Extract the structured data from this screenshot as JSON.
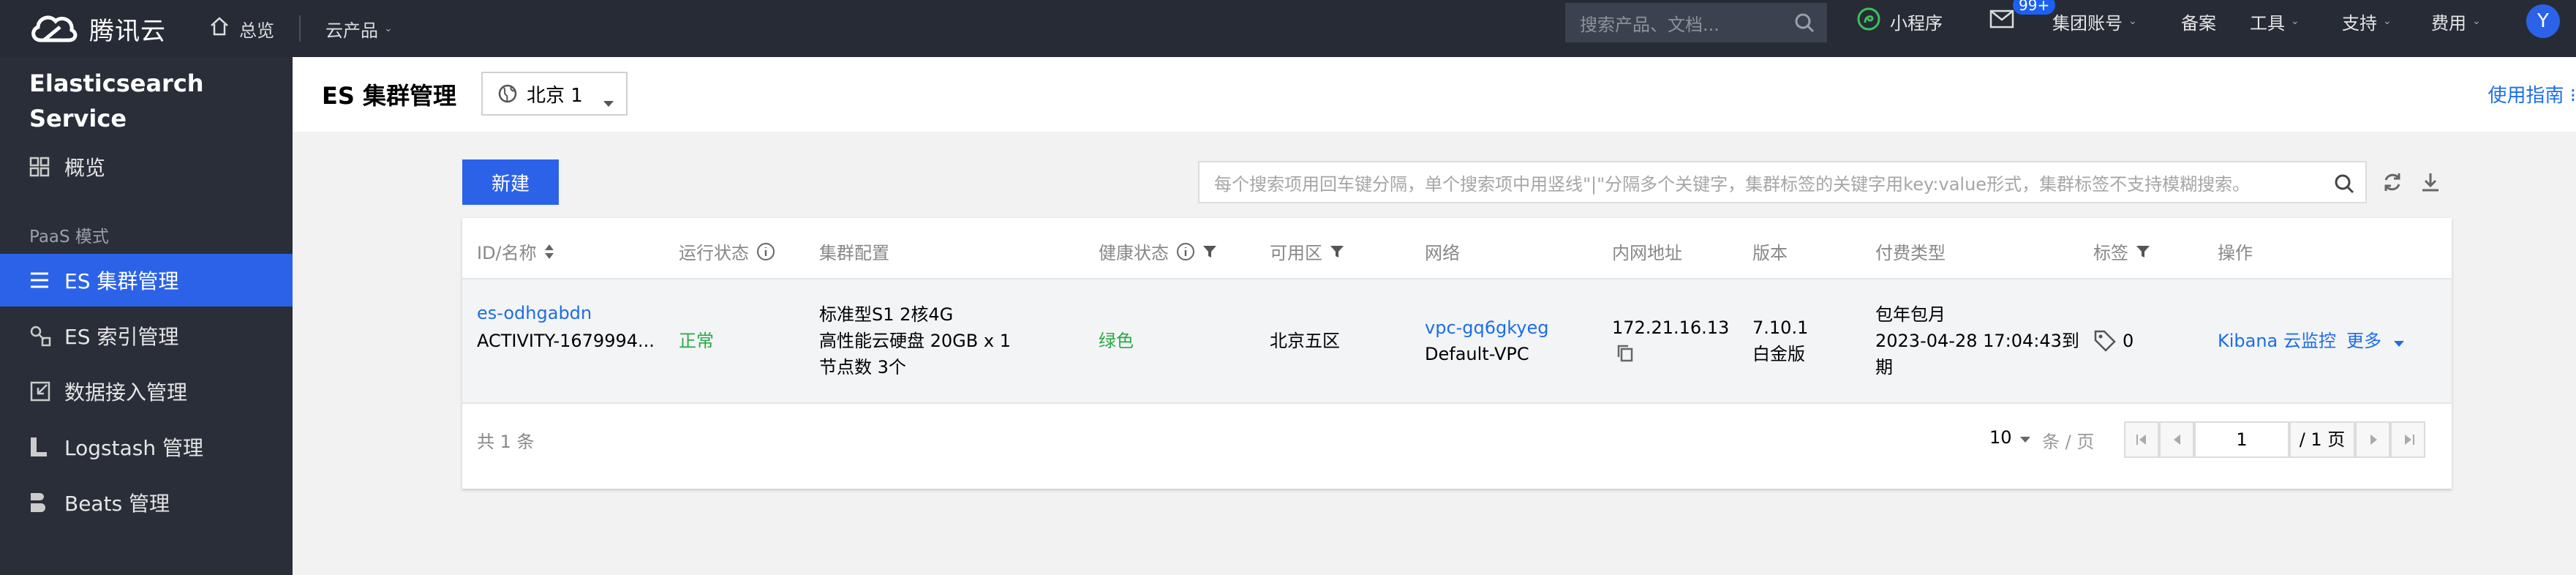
{
  "topbar": {
    "logo_text": "腾讯云",
    "overview_label": "总览",
    "products_label": "云产品",
    "search_placeholder": "搜索产品、文档...",
    "mini_program_label": "小程序",
    "mail_badge": "99+",
    "group_account_label": "集团账号",
    "record_label": "备案",
    "tools_label": "工具",
    "support_label": "支持",
    "billing_label": "费用",
    "avatar_letter": "Y"
  },
  "sidebar": {
    "product_title_line1": "Elasticsearch",
    "product_title_line2": "Service",
    "overview_label": "概览",
    "section_label": "PaaS 模式",
    "items": [
      {
        "label": "ES 集群管理",
        "active": true
      },
      {
        "label": "ES 索引管理"
      },
      {
        "label": "数据接入管理"
      },
      {
        "label": "Logstash 管理"
      },
      {
        "label": "Beats 管理"
      }
    ]
  },
  "header": {
    "title": "ES 集群管理",
    "region": "北京 1",
    "guide_link": "使用指南 ⁝"
  },
  "toolbar": {
    "new_button": "新建",
    "filter_placeholder": "每个搜索项用回车键分隔，单个搜索项中用竖线\"|\"分隔多个关键字，集群标签的关键字用key:value形式，集群标签不支持模糊搜索。"
  },
  "table": {
    "headers": {
      "id_name": "ID/名称",
      "run_status": "运行状态",
      "config": "集群配置",
      "health": "健康状态",
      "zone": "可用区",
      "network": "网络",
      "private_ip": "内网地址",
      "version": "版本",
      "billing": "付费类型",
      "tags": "标签",
      "actions": "操作"
    },
    "row": {
      "id": "es-odhgabdn",
      "name": "ACTIVITY-1679994...",
      "status": "正常",
      "config_line1": "标准型S1 2核4G",
      "config_line2": "高性能云硬盘 20GB x 1",
      "config_line3": "节点数 3个",
      "health": "绿色",
      "zone": "北京五区",
      "vpc_id": "vpc-gq6gkyeg",
      "vpc_name": "Default-VPC",
      "ip": "172.21.16.13",
      "version": "7.10.1",
      "edition": "白金版",
      "billing_line1": "包年包月",
      "billing_line2": "2023-04-28 17:04:43到",
      "billing_line3": "期",
      "tag_count": "0",
      "action_kibana": "Kibana",
      "action_monitor": "云监控",
      "action_more": "更多"
    },
    "footer": {
      "total": "共 1 条",
      "page_size": "10",
      "per_page_label": "条 / 页",
      "current_page": "1",
      "total_pages": "/ 1 页"
    }
  },
  "colors": {
    "topbar_bg": "#262b36",
    "sidebar_bg": "#292e38",
    "accent": "#2b62e8",
    "link": "#1c6ee6",
    "healthy": "#2aa946"
  }
}
